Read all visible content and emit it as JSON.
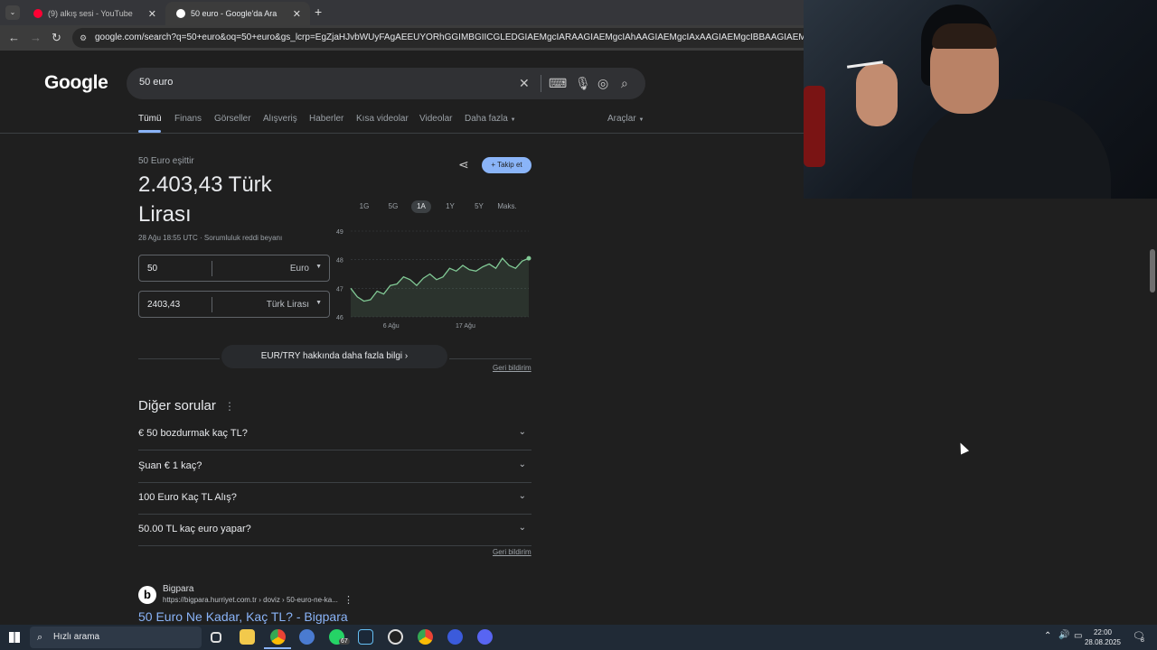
{
  "browser": {
    "tabs": [
      {
        "label": "(9) alkış sesi - YouTube",
        "active": false
      },
      {
        "label": "50 euro - Google'da Ara",
        "active": true
      }
    ],
    "url": "google.com/search?q=50+euro&oq=50+euro&gs_lcrp=EgZjaHJvbWUyFAgAEEUYORhGGIMBGIICGLEDGIAEMgcIARAAGIAEMgcIAhAAGIAEMgcIAxAAGIAEMgcIBBAAGIAEMgcIBRAAGIAEMgcIB"
  },
  "search": {
    "logo": "Google",
    "query": "50 euro",
    "tabs": [
      "Tümü",
      "Finans",
      "Görseller",
      "Alışveriş",
      "Haberler",
      "Kısa videolar",
      "Videolar",
      "Daha fazla"
    ],
    "tools": "Araçlar"
  },
  "converter": {
    "label": "50 Euro eşittir",
    "result": "2.403,43 Türk Lirası",
    "timestamp": "28 Ağu 18:55 UTC · Sorumluluk reddi beyanı",
    "from_value": "50",
    "from_currency": "Euro",
    "to_value": "2403,43",
    "to_currency": "Türk Lirası",
    "follow": "Takip et",
    "ranges": [
      "1G",
      "5G",
      "1A",
      "1Y",
      "5Y",
      "Maks."
    ],
    "active_range": "1A",
    "more_info": "EUR/TRY hakkında daha fazla bilgi",
    "feedback": "Geri bildirim"
  },
  "chart_data": {
    "type": "line",
    "x_ticks": [
      "6 Ağu",
      "17 Ağu"
    ],
    "y_ticks": [
      49,
      48,
      47,
      46
    ],
    "ylim": [
      46,
      49
    ],
    "values": [
      47.0,
      46.7,
      46.55,
      46.6,
      46.9,
      46.8,
      47.1,
      47.15,
      47.4,
      47.3,
      47.1,
      47.35,
      47.5,
      47.3,
      47.4,
      47.7,
      47.6,
      47.8,
      47.65,
      47.6,
      47.75,
      47.85,
      47.7,
      48.05,
      47.8,
      47.7,
      47.95,
      48.05
    ]
  },
  "paa": {
    "title": "Diğer sorular",
    "questions": [
      "€ 50 bozdurmak kaç TL?",
      "Şuan € 1 kaç?",
      "100 Euro Kaç TL Alış?",
      "50.00 TL kaç euro yapar?"
    ],
    "feedback": "Geri bildirim"
  },
  "result": {
    "site": "Bigpara",
    "url": "https://bigpara.hurriyet.com.tr › doviz › 50-euro-ne-ka...",
    "title": "50 Euro Ne Kadar, Kaç TL? - Bigpara"
  },
  "taskbar": {
    "search_placeholder": "Hızlı arama",
    "time": "22:00",
    "date": "28.08.2025",
    "badge_steam": "67",
    "notif_count": "8"
  },
  "colors": {
    "accent": "#8ab4f8",
    "chart_line": "#81c995",
    "page_bg": "#1f1f1f"
  }
}
